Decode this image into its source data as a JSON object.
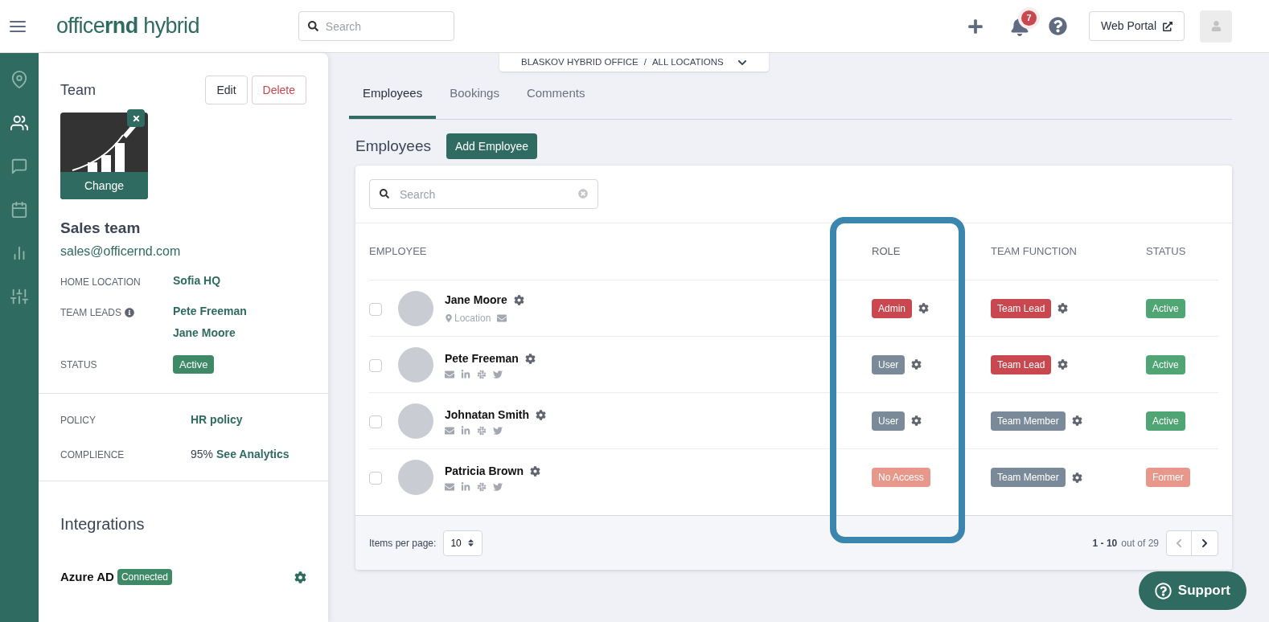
{
  "header": {
    "logo": "office**rnd** hybrid",
    "search_placeholder": "Search",
    "notification_count": "7",
    "web_portal": "Web Portal"
  },
  "rail": [
    {
      "kind": "location",
      "selected": false
    },
    {
      "kind": "team",
      "selected": true
    },
    {
      "kind": "chat",
      "selected": false
    },
    {
      "kind": "calendar",
      "selected": false
    },
    {
      "kind": "chart",
      "selected": false
    },
    {
      "kind": "sliders",
      "selected": false
    }
  ],
  "team_panel": {
    "title": "Team",
    "edit": "Edit",
    "delete": "Delete",
    "change": "Change",
    "name": "Sales team",
    "email": "sales@officernd.com",
    "fields": [
      {
        "kind": "links",
        "label": "HOME LOCATION",
        "values": [
          "Sofia HQ"
        ],
        "info": false
      },
      {
        "kind": "links",
        "label": "TEAM LEADS",
        "values": [
          "Pete Freeman",
          "Jane Moore"
        ],
        "info": true
      },
      {
        "kind": "badge",
        "label": "STATUS",
        "values": [
          "Active"
        ],
        "info": false
      }
    ],
    "policy_fields": [
      {
        "label": "POLICY",
        "link": "HR policy"
      },
      {
        "label": "COMPLIENCE",
        "prefix": "95%",
        "link": "See Analytics"
      }
    ],
    "integrations_title": "Integrations",
    "integrations": [
      {
        "name": "Azure AD",
        "status": "Connected"
      }
    ]
  },
  "location_bar": {
    "office": "BLASKOV HYBRID OFFICE",
    "separator": "/",
    "scope": "ALL LOCATIONS"
  },
  "tabs": [
    {
      "label": "Employees",
      "selected": true
    },
    {
      "label": "Bookings",
      "selected": false
    },
    {
      "label": "Comments",
      "selected": false
    }
  ],
  "section_title": "Employees",
  "add_button": "Add Employee",
  "table_search_placeholder": "Search",
  "table": {
    "columns": [
      {
        "label": "EMPLOYEE",
        "highlighted": false
      },
      {
        "label": "ROLE",
        "highlighted": true
      },
      {
        "label": "TEAM FUNCTION",
        "highlighted": false
      },
      {
        "label": "STATUS",
        "highlighted": false
      }
    ],
    "rows": [
      {
        "checked": false,
        "name": "Jane Moore",
        "location": "Location",
        "contacts": [
          {
            "kind": "email"
          }
        ],
        "role": {
          "label": "Admin",
          "color": "#c9474f",
          "settings": true
        },
        "team_function": {
          "label": "Team Lead",
          "color": "#c9474f",
          "settings": true
        },
        "status": {
          "label": "Active",
          "color": "#4fa674"
        }
      },
      {
        "checked": false,
        "name": "Pete Freeman",
        "contacts": [
          {
            "kind": "email"
          },
          {
            "kind": "linkedin"
          },
          {
            "kind": "slack"
          },
          {
            "kind": "twitter"
          }
        ],
        "role": {
          "label": "User",
          "color": "#7b8a98",
          "settings": true
        },
        "team_function": {
          "label": "Team Lead",
          "color": "#c9474f",
          "settings": true
        },
        "status": {
          "label": "Active",
          "color": "#4fa674"
        }
      },
      {
        "checked": false,
        "name": "Johnatan Smith",
        "contacts": [
          {
            "kind": "email"
          },
          {
            "kind": "linkedin"
          },
          {
            "kind": "slack"
          },
          {
            "kind": "twitter"
          }
        ],
        "role": {
          "label": "User",
          "color": "#7b8a98",
          "settings": true
        },
        "team_function": {
          "label": "Team Member",
          "color": "#7b8a98",
          "settings": true
        },
        "status": {
          "label": "Active",
          "color": "#4fa674"
        }
      },
      {
        "checked": false,
        "name": "Patricia Brown",
        "contacts": [
          {
            "kind": "email"
          },
          {
            "kind": "linkedin"
          },
          {
            "kind": "slack"
          },
          {
            "kind": "twitter"
          }
        ],
        "role": {
          "label": "No Access",
          "color": "#e8988a",
          "settings": false
        },
        "team_function": {
          "label": "Team Member",
          "color": "#7b8a98",
          "settings": true
        },
        "status": {
          "label": "Former",
          "color": "#e8988a"
        }
      }
    ]
  },
  "footer": {
    "items_label": "Items per page:",
    "items_value": "10",
    "range": "1 - 10",
    "total": "out of 29"
  },
  "support": "Support"
}
